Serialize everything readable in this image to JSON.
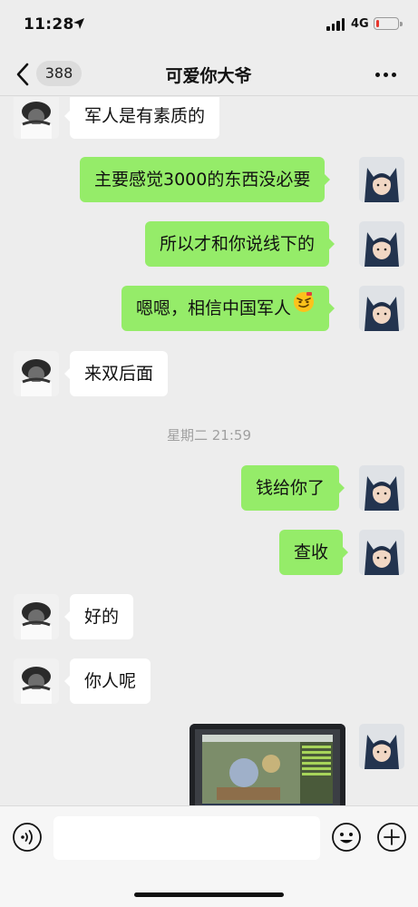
{
  "status_bar": {
    "time": "11:28",
    "network": "4G",
    "battery_level": 0.15,
    "battery_color": "#e8362d"
  },
  "nav": {
    "back_icon": "chevron-left-icon",
    "unread_count": "388",
    "title": "可爱你大爷",
    "more_icon": "more-dots-icon"
  },
  "colors": {
    "outgoing_bubble": "#95ec69",
    "incoming_bubble": "#ffffff",
    "background": "#ededed"
  },
  "messages": [
    {
      "sender": "other",
      "text": "军人是有素质的"
    },
    {
      "sender": "me",
      "text": "主要感觉3000的东西没必要"
    },
    {
      "sender": "me",
      "text": "所以才和你说线下的"
    },
    {
      "sender": "me",
      "text": "嗯嗯，相信中国军人",
      "emoji": "sly-smile-emoji"
    },
    {
      "sender": "other",
      "text": "来双后面"
    },
    {
      "type": "timestamp",
      "text": "星期二 21:59"
    },
    {
      "sender": "me",
      "text": "钱给你了"
    },
    {
      "sender": "me",
      "text": "查收"
    },
    {
      "sender": "other",
      "text": "好的"
    },
    {
      "sender": "other",
      "text": "你人呢"
    },
    {
      "sender": "me",
      "type": "image",
      "description_icon": "photo-thumbnail"
    }
  ],
  "input_bar": {
    "voice_icon": "voice-icon",
    "placeholder": "",
    "emoji_icon": "smiley-icon",
    "plus_icon": "plus-icon"
  }
}
